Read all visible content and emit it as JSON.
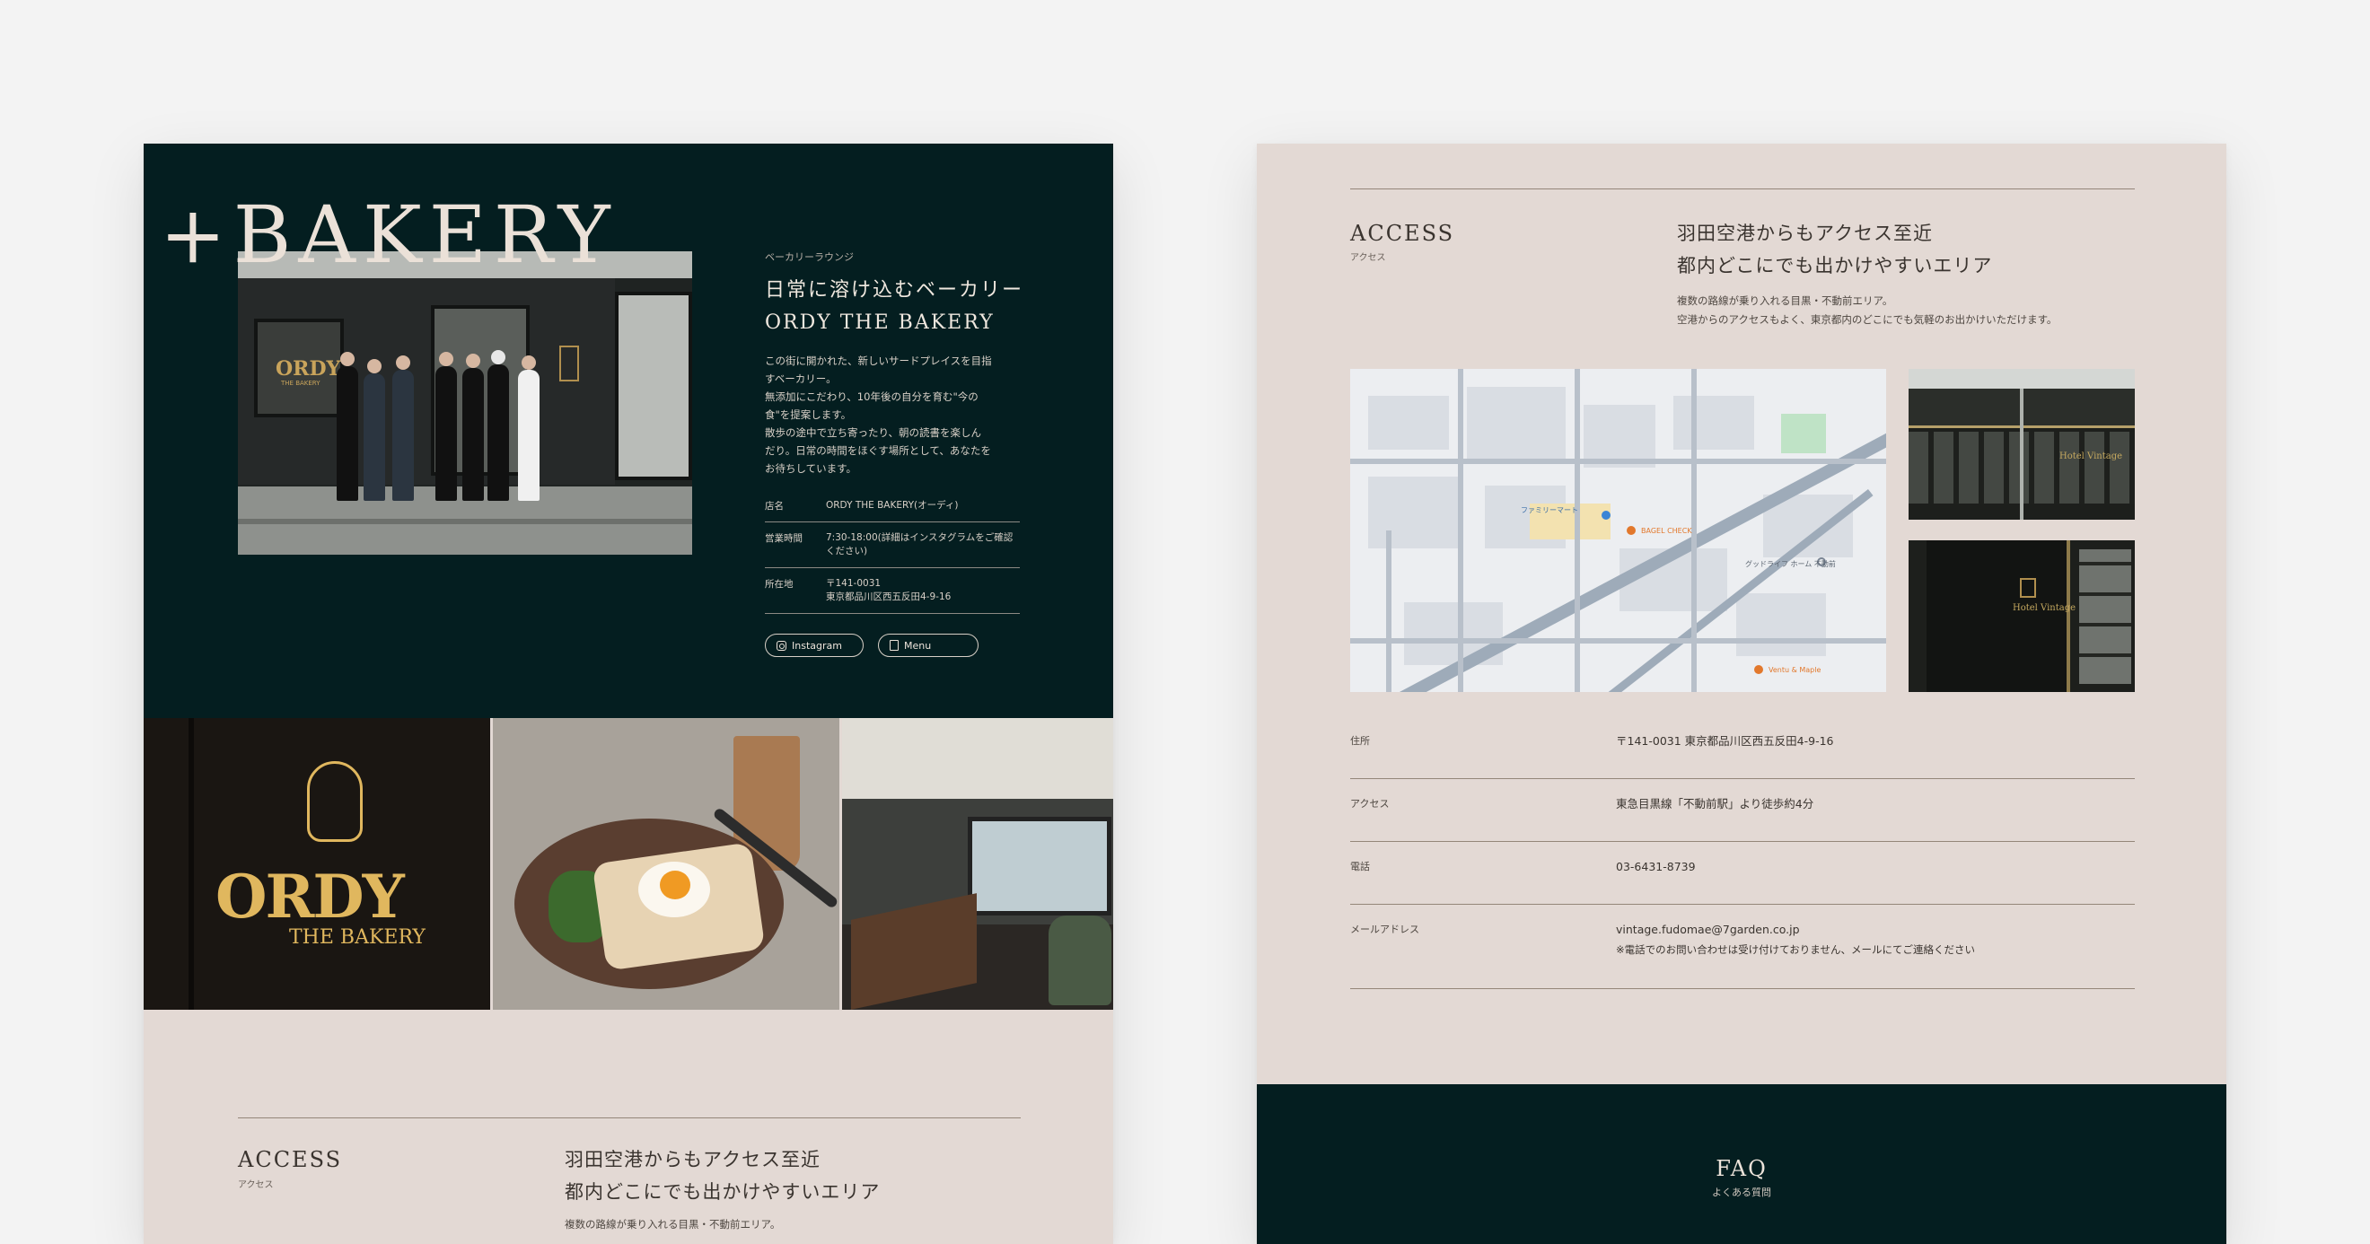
{
  "hero": {
    "wordmark": "+BAKERY",
    "eyebrow": "ベーカリーラウンジ",
    "title_line1": "日常に溶け込むベーカリー",
    "title_line2": "ORDY THE BAKERY",
    "description": "この街に開かれた、新しいサードプレイスを目指\nすベーカリー。\n無添加にこだわり、10年後の自分を育む\"今の\n食\"を提案します。\n散歩の途中で立ち寄ったり、朝の読書を楽しん\nだり。日常の時間をほぐす場所として、あなたを\nお待ちしています。",
    "photo_sign": "ORDY",
    "photo_sign_sub": "THE BAKERY",
    "info": [
      {
        "key": "店名",
        "value": "ORDY THE BAKERY(オーディ)"
      },
      {
        "key": "営業時間",
        "value": "7:30-18:00(詳細はインスタグラムをご確認ください)"
      },
      {
        "key": "所在地",
        "value": "〒141-0031\n東京都品川区西五反田4-9-16"
      }
    ],
    "buttons": [
      {
        "label": "Instagram",
        "icon": "instagram-icon"
      },
      {
        "label": "Menu",
        "icon": "menu-icon"
      }
    ]
  },
  "strip": {
    "logo": "ORDY",
    "logo_sub": "THE BAKERY"
  },
  "access_left": {
    "title": "ACCESS",
    "sub": "アクセス",
    "head_line1": "羽田空港からもアクセス至近",
    "head_line2": "都内どこにでも出かけやすいエリア",
    "desc": "複数の路線が乗り入れる目黒・不動前エリア。"
  },
  "access_right": {
    "title": "ACCESS",
    "sub": "アクセス",
    "head_line1": "羽田空港からもアクセス至近",
    "head_line2": "都内どこにでも出かけやすいエリア",
    "desc": "複数の路線が乗り入れる目黒・不動前エリア。\n空港からのアクセスもよく、東京都内のどこにでも気軽のお出かけいただけます。",
    "map_labels": [
      "BAGEL CHECK",
      "ファミリーマート",
      "グッドライフ ホーム 不動前",
      "Ventu & Maple"
    ],
    "hotel_sign": "Hotel Vintage",
    "details": [
      {
        "key": "住所",
        "value": "〒141-0031 東京都品川区西五反田4-9-16"
      },
      {
        "key": "アクセス",
        "value": "東急目黒線「不動前駅」より徒歩約4分"
      },
      {
        "key": "電話",
        "value": "03-6431-8739"
      },
      {
        "key": "メールアドレス",
        "value": "vintage.fudomae@7garden.co.jp",
        "note": "※電話でのお問い合わせは受け付けておりません、メールにてご連絡ください"
      }
    ]
  },
  "faq": {
    "title": "FAQ",
    "sub": "よくある質問"
  },
  "colors": {
    "dark_teal": "#041e20",
    "beige": "#e3d9d4",
    "gold": "#e0b75e",
    "rule": "#948679"
  }
}
